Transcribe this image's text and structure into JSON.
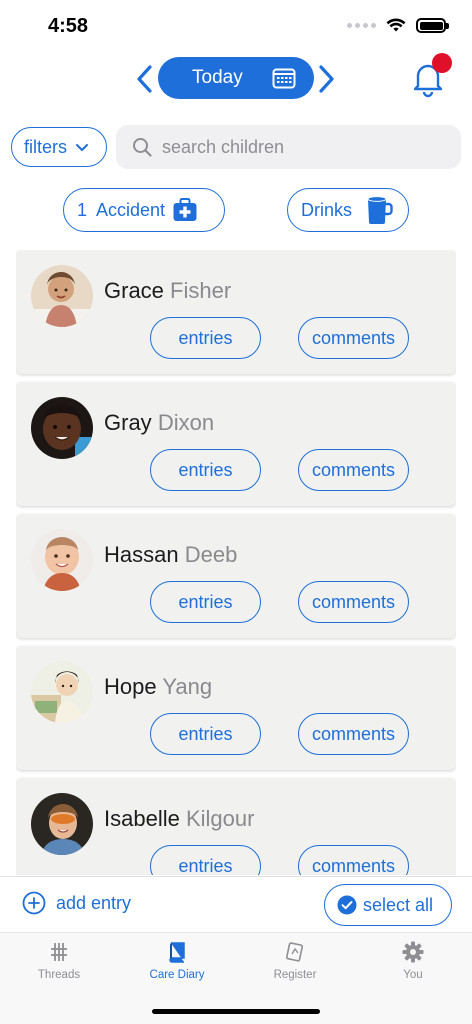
{
  "status_bar": {
    "time": "4:58"
  },
  "header": {
    "date_label": "Today",
    "prev_icon": "chevron-left-icon",
    "next_icon": "chevron-right-icon",
    "calendar_icon": "calendar-icon",
    "notification_icon": "bell-icon",
    "notification_badge_color": "#e0102a"
  },
  "filters": {
    "label": "filters",
    "icon": "chevron-down-icon"
  },
  "search": {
    "placeholder": "search children",
    "icon": "search-icon"
  },
  "chips": [
    {
      "label": "1  Accident",
      "icon": "first-aid-kit-icon"
    },
    {
      "label": "Drinks",
      "icon": "cup-icon"
    }
  ],
  "children": [
    {
      "first": "Grace",
      "last": "Fisher",
      "entries_label": "entries",
      "comments_label": "comments"
    },
    {
      "first": "Gray",
      "last": "Dixon",
      "entries_label": "entries",
      "comments_label": "comments"
    },
    {
      "first": "Hassan",
      "last": "Deeb",
      "entries_label": "entries",
      "comments_label": "comments"
    },
    {
      "first": "Hope",
      "last": "Yang",
      "entries_label": "entries",
      "comments_label": "comments"
    },
    {
      "first": "Isabelle",
      "last": "Kilgour",
      "entries_label": "entries",
      "comments_label": "comments"
    }
  ],
  "actions": {
    "add_entry": "add entry",
    "select_all": "select all"
  },
  "tabs": [
    {
      "label": "Threads",
      "icon": "hashtag-icon"
    },
    {
      "label": "Care Diary",
      "icon": "book-icon"
    },
    {
      "label": "Register",
      "icon": "register-icon"
    },
    {
      "label": "You",
      "icon": "gear-icon"
    }
  ],
  "colors": {
    "accent": "#1e6fd9",
    "card": "#f1f1f0",
    "badge": "#e0102a"
  }
}
